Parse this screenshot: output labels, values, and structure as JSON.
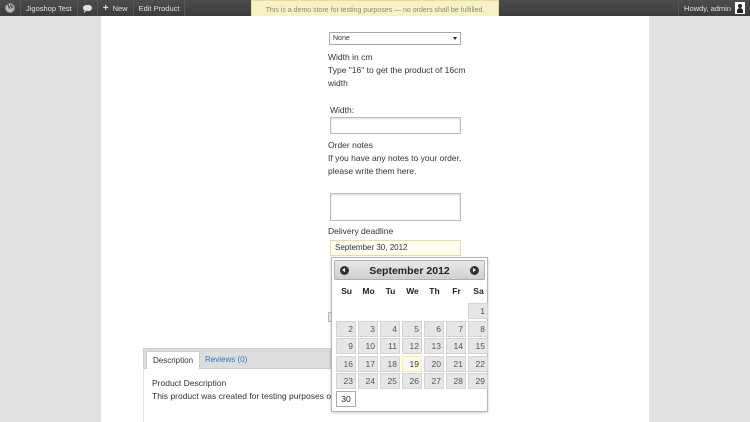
{
  "admin_bar": {
    "site_name": "Jigoshop Test",
    "new_label": "New",
    "edit_label": "Edit Product",
    "greeting": "Howdy, admin"
  },
  "demo_notice": "This is a demo store for testing purposes — no orders shall be fulfilled.",
  "form": {
    "select_value": "None",
    "width_title": "Width in cm",
    "width_hint_line1": "Type \"16\" to get the product of 16cm",
    "width_hint_line2": "width",
    "width_label": "Width:",
    "notes_title": "Order notes",
    "notes_hint_line1": "If you have any notes to your order,",
    "notes_hint_line2": "please write them here.",
    "deadline_label": "Delivery deadline",
    "deadline_value": "September 30, 2012"
  },
  "tabs": {
    "description": "Description",
    "reviews": "Reviews (0)",
    "panel_title": "Product Description",
    "panel_text": "This product was created for testing purposes of F"
  },
  "datepicker": {
    "title": "September 2012",
    "days_of_week": [
      "Su",
      "Mo",
      "Tu",
      "We",
      "Th",
      "Fr",
      "Sa"
    ],
    "weeks": [
      [
        "",
        "",
        "",
        "",
        "",
        "",
        "1"
      ],
      [
        "2",
        "3",
        "4",
        "5",
        "6",
        "7",
        "8"
      ],
      [
        "9",
        "10",
        "11",
        "12",
        "13",
        "14",
        "15"
      ],
      [
        "16",
        "17",
        "18",
        "19",
        "20",
        "21",
        "22"
      ],
      [
        "23",
        "24",
        "25",
        "26",
        "27",
        "28",
        "29"
      ],
      [
        "30",
        "",
        "",
        "",
        "",
        "",
        ""
      ]
    ],
    "today": "19",
    "selected": "30"
  }
}
